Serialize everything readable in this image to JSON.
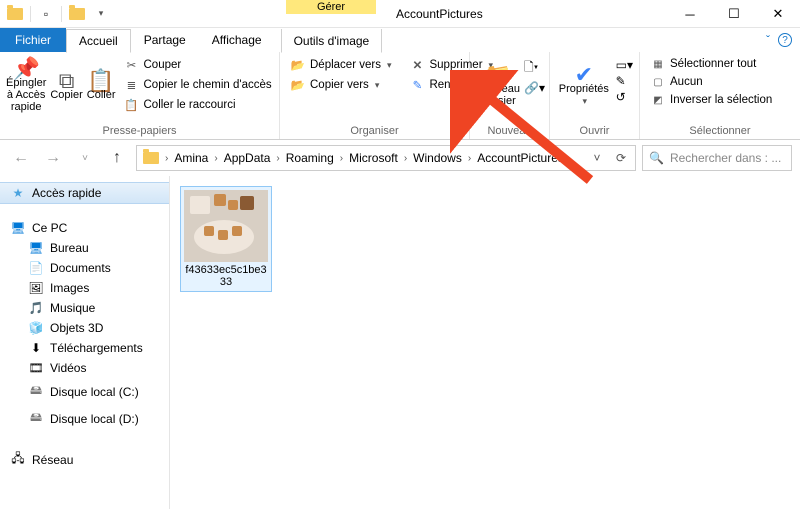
{
  "title": "AccountPictures",
  "contextual_tab": "Gérer",
  "contextual_group": "Outils d'image",
  "tabs": {
    "file": "Fichier",
    "home": "Accueil",
    "share": "Partage",
    "view": "Affichage"
  },
  "ribbon": {
    "clipboard": {
      "pin": "Épingler à Accès rapide",
      "copy": "Copier",
      "paste": "Coller",
      "cut": "Couper",
      "copy_path": "Copier le chemin d'accès",
      "paste_shortcut": "Coller le raccourci",
      "label": "Presse-papiers"
    },
    "organize": {
      "move_to": "Déplacer vers",
      "copy_to": "Copier vers",
      "delete": "Supprimer",
      "rename": "Renommer",
      "label": "Organiser"
    },
    "new": {
      "new_folder": "Nouveau dossier",
      "label": "Nouveau"
    },
    "open": {
      "properties": "Propriétés",
      "label": "Ouvrir"
    },
    "select": {
      "select_all": "Sélectionner tout",
      "none": "Aucun",
      "invert": "Inverser la sélection",
      "label": "Sélectionner"
    }
  },
  "breadcrumbs": [
    "Amina",
    "AppData",
    "Roaming",
    "Microsoft",
    "Windows",
    "AccountPictures"
  ],
  "search_placeholder": "Rechercher dans : ...",
  "sidebar": {
    "quick": "Accès rapide",
    "this_pc": "Ce PC",
    "items": [
      "Bureau",
      "Documents",
      "Images",
      "Musique",
      "Objets 3D",
      "Téléchargements",
      "Vidéos",
      "Disque local (C:)",
      "Disque local (D:)"
    ],
    "network": "Réseau"
  },
  "file": {
    "name": "f43633ec5c1be333"
  }
}
